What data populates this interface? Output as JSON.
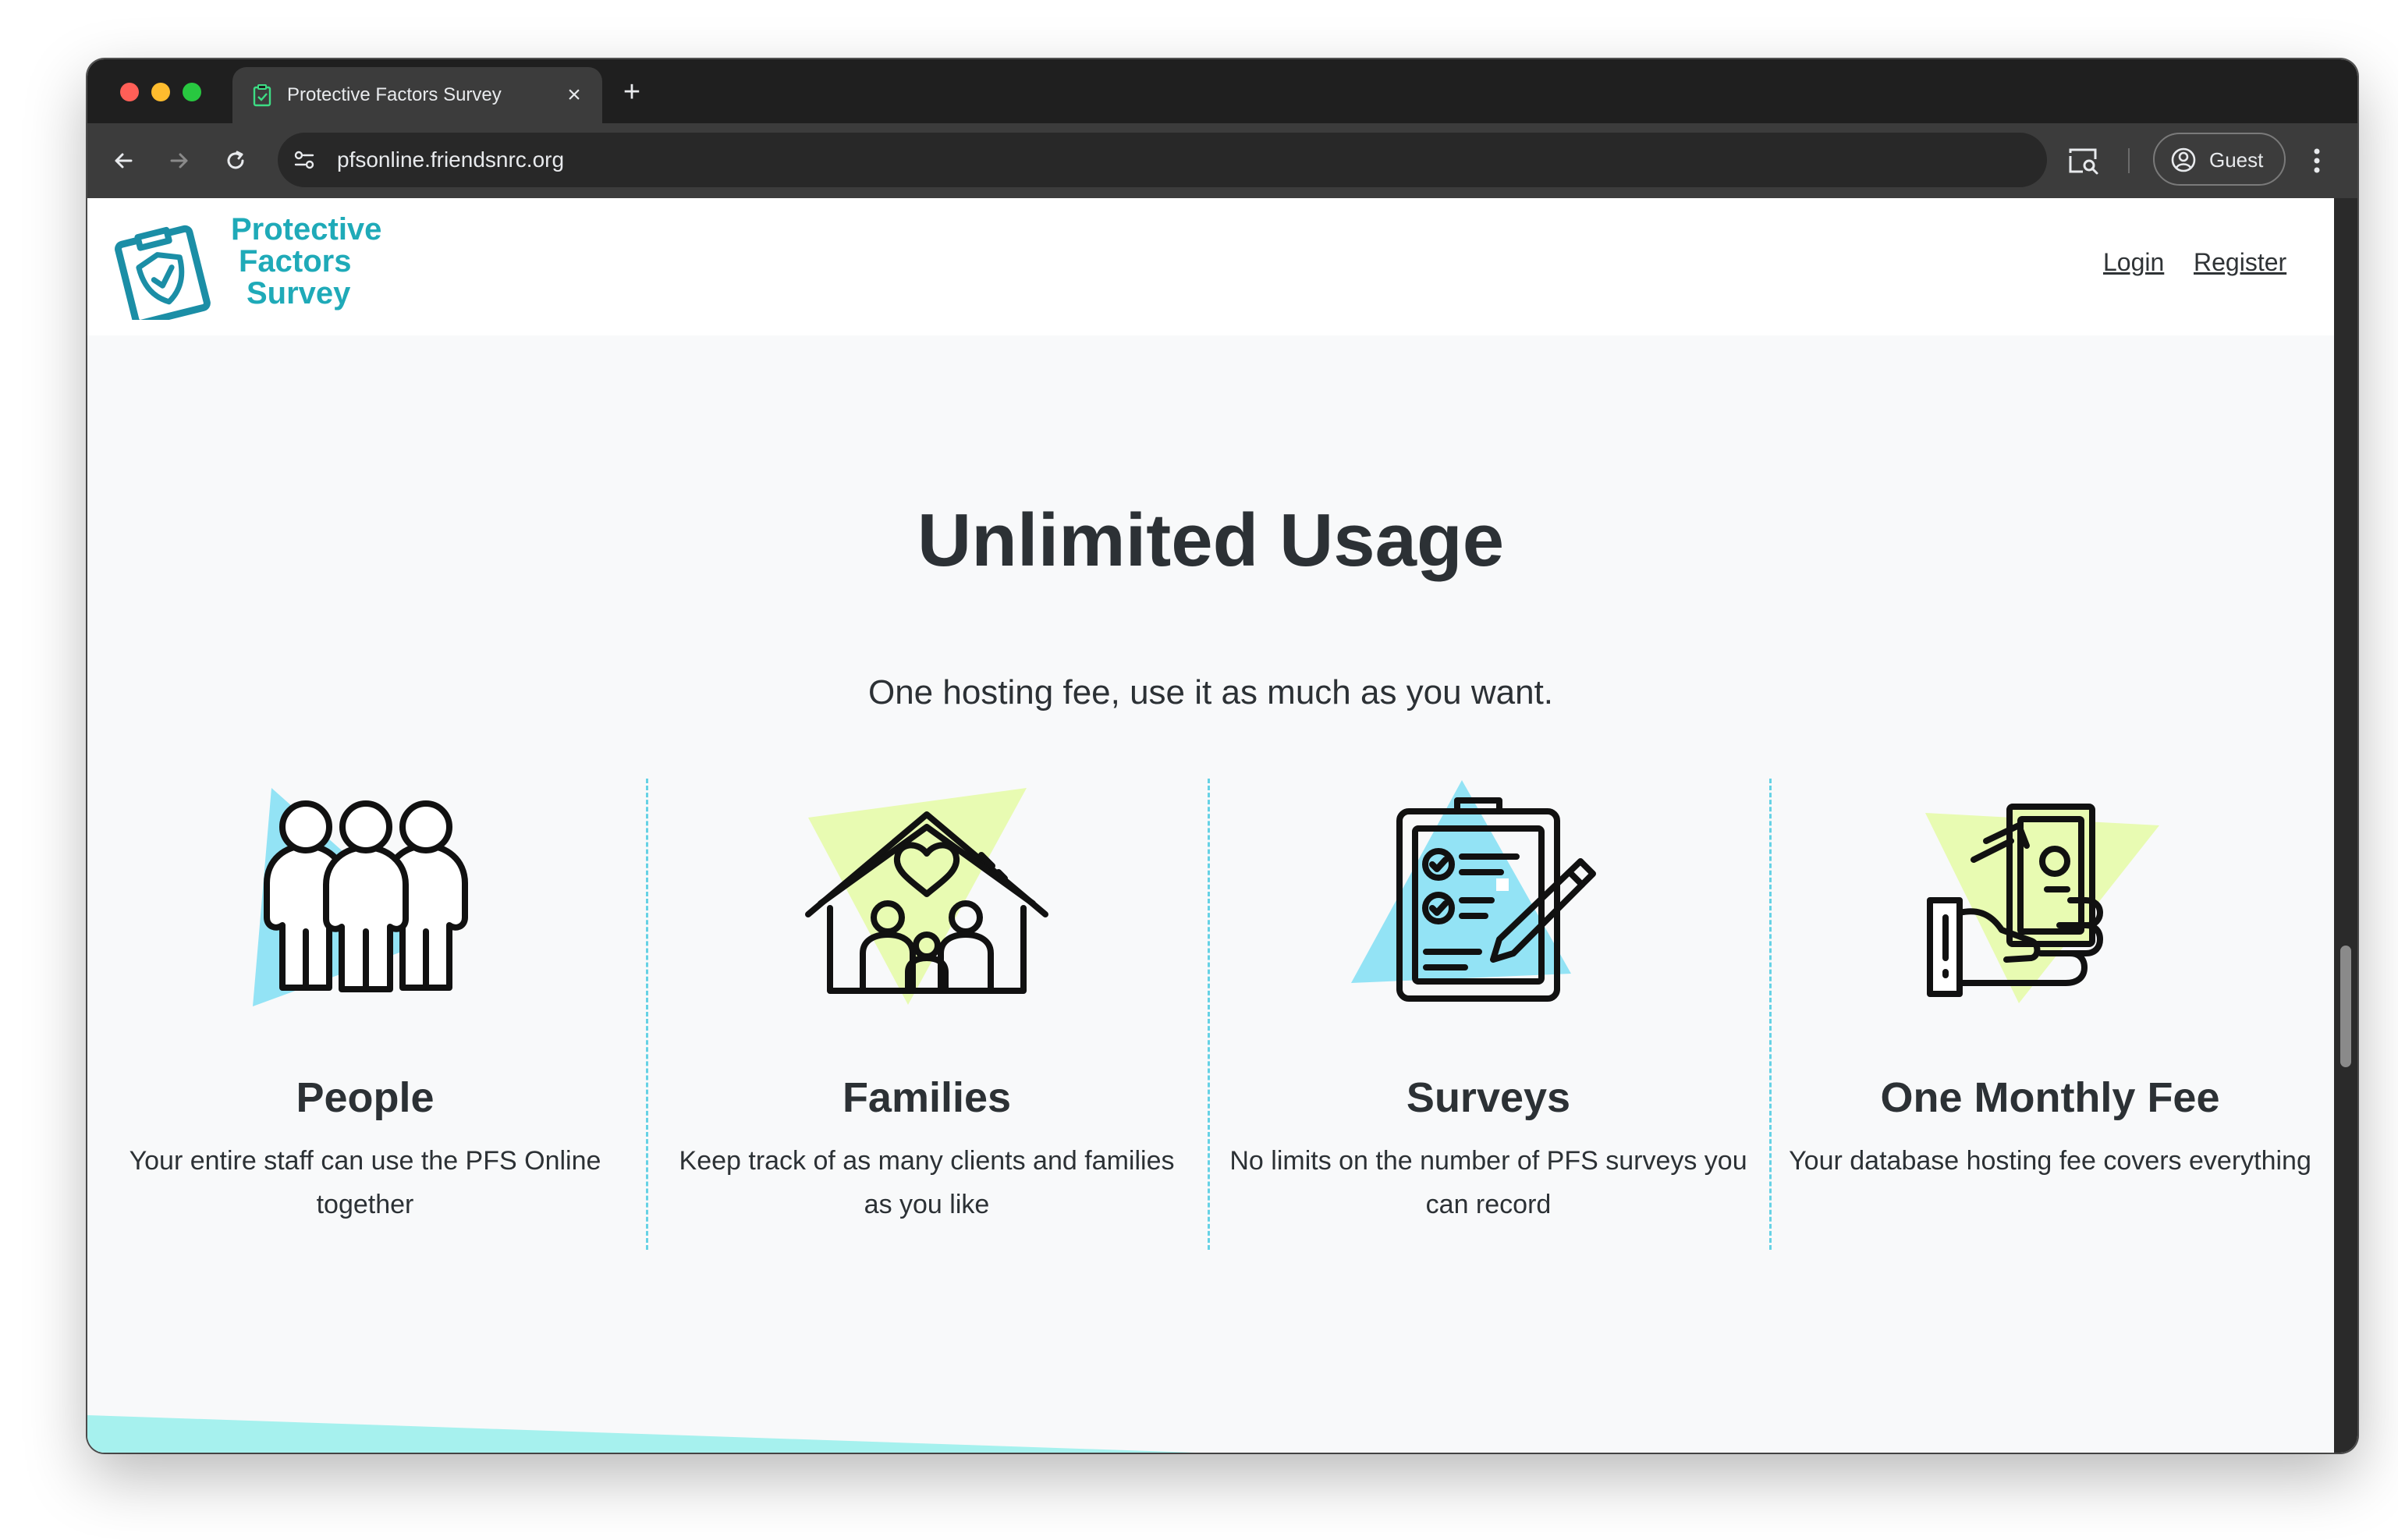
{
  "browser": {
    "tab_title": "Protective Factors Survey",
    "tab_close": "×",
    "new_tab": "+",
    "url": "pfsonline.friendsnrc.org",
    "profile_label": "Guest"
  },
  "header": {
    "logo_line1": "Protective",
    "logo_line2": "Factors",
    "logo_line3": "Survey",
    "login": "Login",
    "register": "Register"
  },
  "hero": {
    "title": "Unlimited Usage",
    "subtitle": "One hosting fee, use it as much as you want."
  },
  "features": [
    {
      "title": "People",
      "description": "Your entire staff can use the PFS Online together",
      "icon": "people-icon"
    },
    {
      "title": "Families",
      "description": "Keep track of as many clients and families as you like",
      "icon": "family-house-icon"
    },
    {
      "title": "Surveys",
      "description": "No limits on the number of PFS surveys you can record",
      "icon": "clipboard-checklist-icon"
    },
    {
      "title": "One Monthly Fee",
      "description": "Your database hosting fee covers everything",
      "icon": "cash-in-hand-icon"
    }
  ],
  "colors": {
    "brand_teal": "#1faab8",
    "accent_blue": "#93e3f5",
    "accent_lime": "#e8fbb2",
    "wedge_teal": "#a6f1ee",
    "divider": "#66d2e5"
  }
}
